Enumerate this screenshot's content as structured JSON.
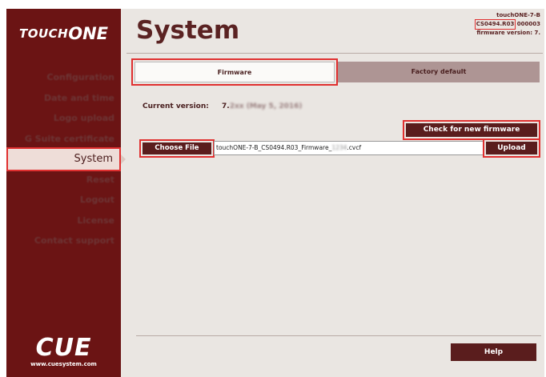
{
  "brand": {
    "touch": "TOUCH",
    "one": "ONE",
    "cue": "CUE",
    "url": "www.cuesystem.com"
  },
  "sidebar": {
    "items": [
      {
        "label": "Configuration"
      },
      {
        "label": "Date and time"
      },
      {
        "label": "Logo upload"
      },
      {
        "label": "G Suite certificate"
      },
      {
        "label": "System"
      },
      {
        "label": "Reset"
      },
      {
        "label": "Logout"
      },
      {
        "label": "License"
      },
      {
        "label": "Contact support"
      }
    ]
  },
  "header": {
    "title": "System",
    "device_name": "touchONE-7-B",
    "model_code": "CS0494.R03",
    "serial_suffix": "000003",
    "firmware_version_label": "firmware version: 7."
  },
  "tabs": {
    "firmware": "Firmware",
    "factory_default": "Factory default"
  },
  "main": {
    "current_version_label": "Current version:",
    "current_version_value": "7.",
    "current_version_blurred": "2xx (May 5, 2016)",
    "check_firmware_label": "Check for new firmware",
    "choose_file_label": "Choose File",
    "file_name_prefix": "touchONE-7-B_CS0494.R03_Firmware_",
    "file_name_blurred": "1234",
    "file_name_suffix": ".cvcf",
    "upload_label": "Upload",
    "help_label": "Help"
  },
  "colors": {
    "sidebar_bg": "#6b1414",
    "accent_dark": "#5a1d1d",
    "highlight_red": "#e03030",
    "content_bg": "#eae6e2"
  }
}
